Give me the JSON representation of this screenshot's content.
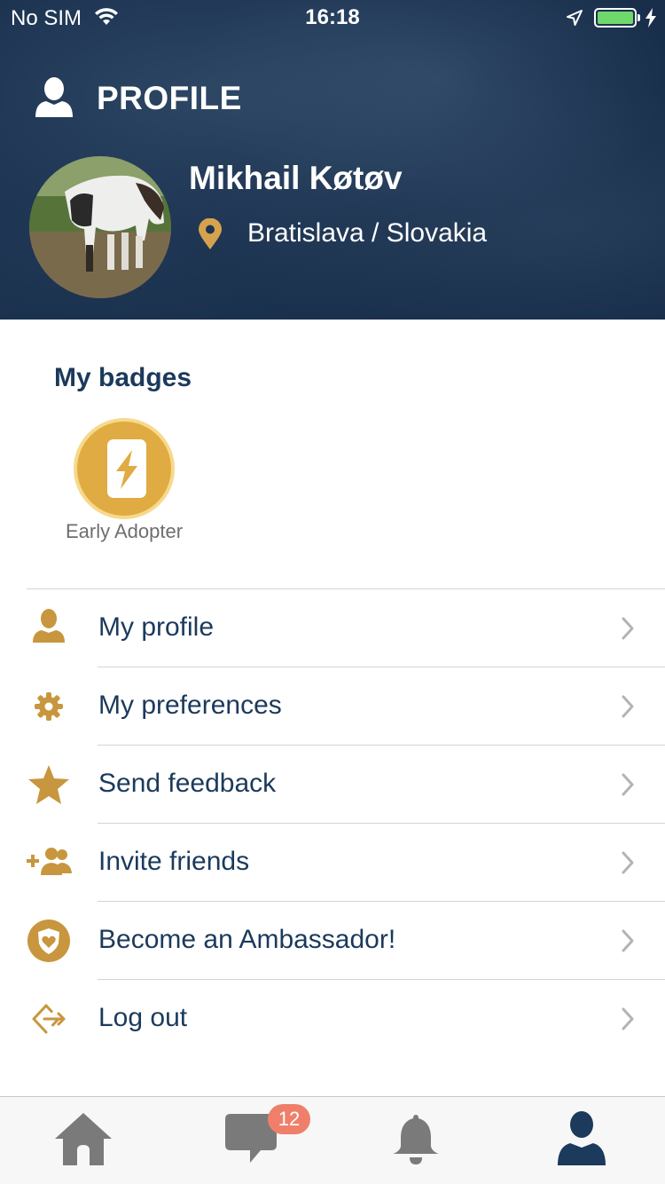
{
  "status_bar": {
    "carrier": "No SIM",
    "time": "16:18"
  },
  "header": {
    "title": "PROFILE",
    "user_name": "Mikhail Køtøv",
    "location": "Bratislava / Slovakia"
  },
  "badges": {
    "title": "My badges",
    "items": [
      {
        "label": "Early Adopter",
        "icon": "phone-bolt-icon"
      }
    ]
  },
  "menu": {
    "items": [
      {
        "label": "My profile",
        "icon": "person-icon"
      },
      {
        "label": "My preferences",
        "icon": "gear-icon"
      },
      {
        "label": "Send feedback",
        "icon": "star-icon"
      },
      {
        "label": "Invite friends",
        "icon": "add-people-icon"
      },
      {
        "label": "Become an Ambassador!",
        "icon": "heart-shield-icon"
      },
      {
        "label": "Log out",
        "icon": "logout-icon"
      }
    ]
  },
  "tab_bar": {
    "items": [
      {
        "name": "home",
        "icon": "home-icon",
        "active": false
      },
      {
        "name": "messages",
        "icon": "chat-icon",
        "active": false
      },
      {
        "name": "notifications",
        "icon": "bell-icon",
        "active": false
      },
      {
        "name": "profile",
        "icon": "person-icon",
        "active": true
      }
    ],
    "messages_badge": "12"
  },
  "colors": {
    "header_bg": "#1c3350",
    "accent_gold": "#c8963e",
    "text_navy": "#1b3a5c",
    "badge_red": "#ef7f6b",
    "tab_inactive": "#7a7a7a",
    "tab_active": "#1b3a5c"
  }
}
